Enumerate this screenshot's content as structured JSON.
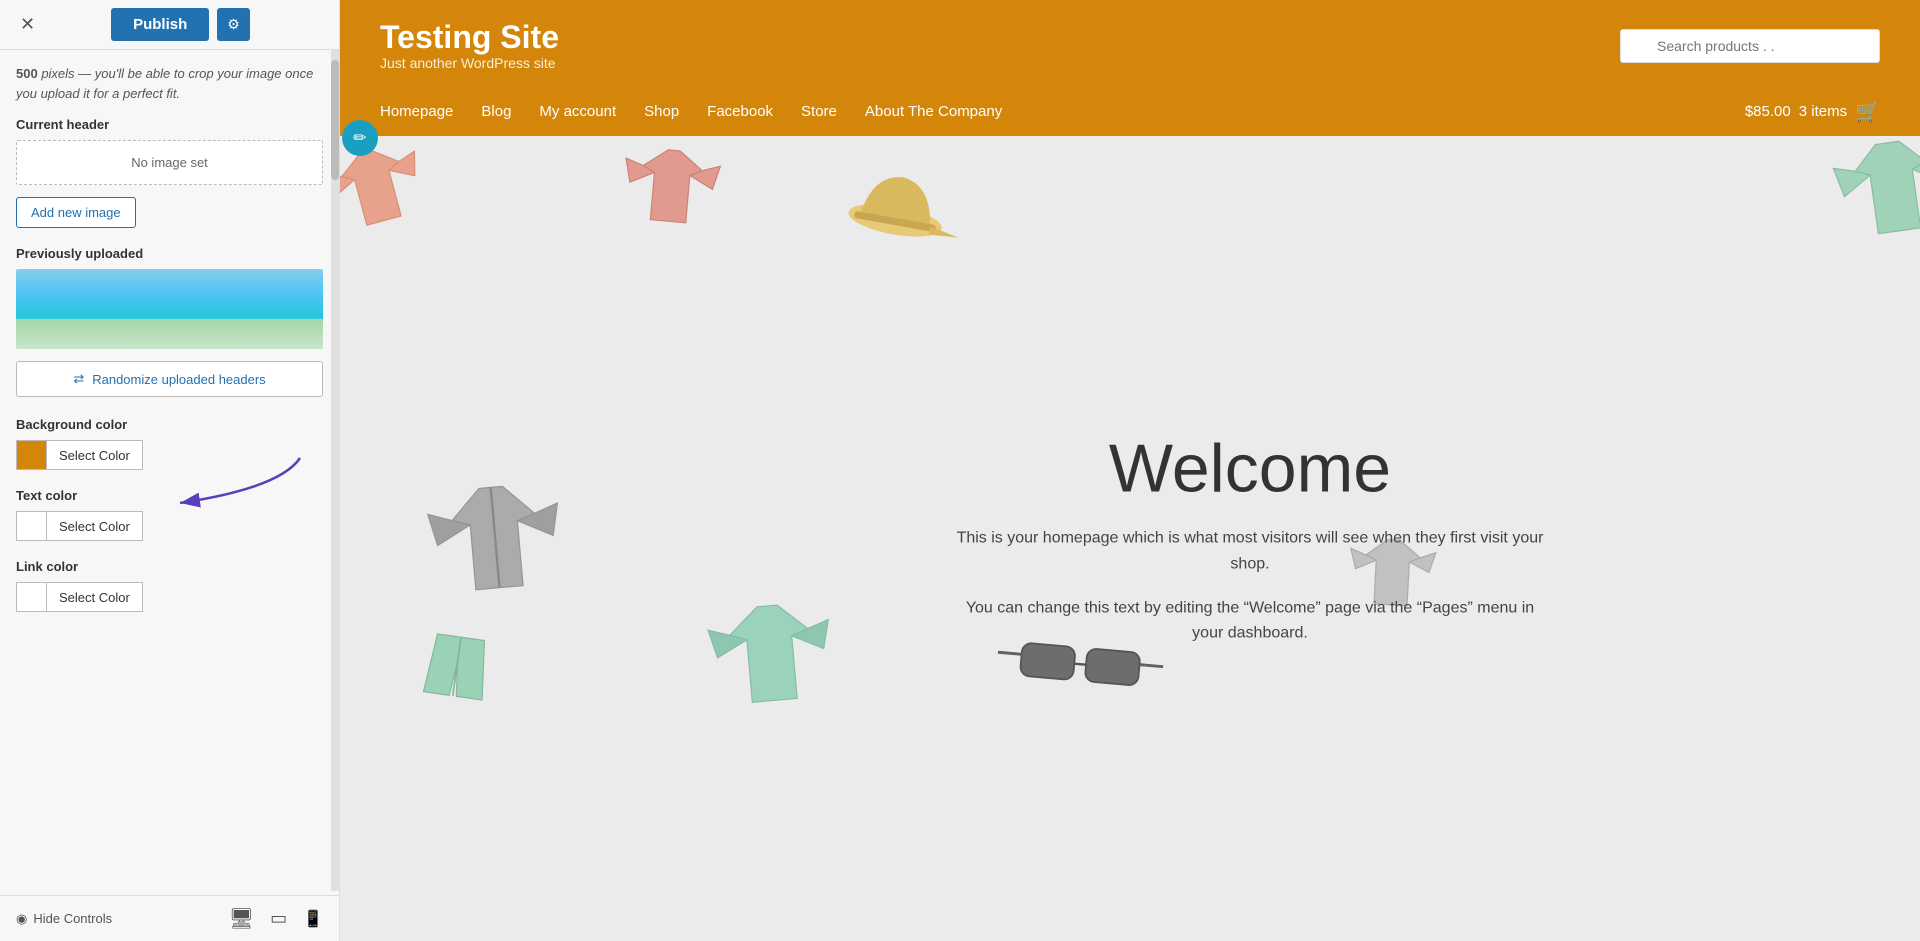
{
  "topbar": {
    "close_label": "✕",
    "publish_label": "Publish",
    "settings_icon": "⚙"
  },
  "panel": {
    "hint_text_bold": "500",
    "hint_text": " pixels — you'll be able to crop your image once you upload it for a perfect fit.",
    "current_header_label": "Current header",
    "no_image_text": "No image set",
    "add_image_label": "Add new image",
    "previously_uploaded_label": "Previously uploaded",
    "randomize_label": "Randomize uploaded headers",
    "randomize_icon": "⇄",
    "bg_color_label": "Background color",
    "bg_select_color_label": "Select Color",
    "text_color_label": "Text color",
    "text_select_color_label": "Select Color",
    "link_color_label": "Link color",
    "link_select_color_label": "Select Color"
  },
  "bottom_bar": {
    "hide_controls_label": "Hide Controls",
    "hide_icon": "◉",
    "desktop_icon": "🖥",
    "tablet_icon": "📱",
    "mobile_icon": "📱"
  },
  "site": {
    "title": "Testing Site",
    "tagline": "Just another WordPress site",
    "search_placeholder": "Search products . .",
    "nav_items": [
      {
        "label": "Homepage"
      },
      {
        "label": "Blog"
      },
      {
        "label": "My account"
      },
      {
        "label": "Shop"
      },
      {
        "label": "Facebook"
      },
      {
        "label": "Store"
      },
      {
        "label": "About The Company"
      }
    ],
    "cart_price": "$85.00",
    "cart_items": "3 items"
  },
  "welcome": {
    "title": "Welcome",
    "body1": "This is your homepage which is what most visitors will see when they first visit your shop.",
    "body2": "You can change this text by editing the “Welcome” page via the “Pages” menu in your dashboard."
  },
  "colors": {
    "header_bg": "#d4860a",
    "bg_swatch": "#d4860a",
    "text_swatch": "#ffffff",
    "link_swatch": "#ffffff"
  }
}
